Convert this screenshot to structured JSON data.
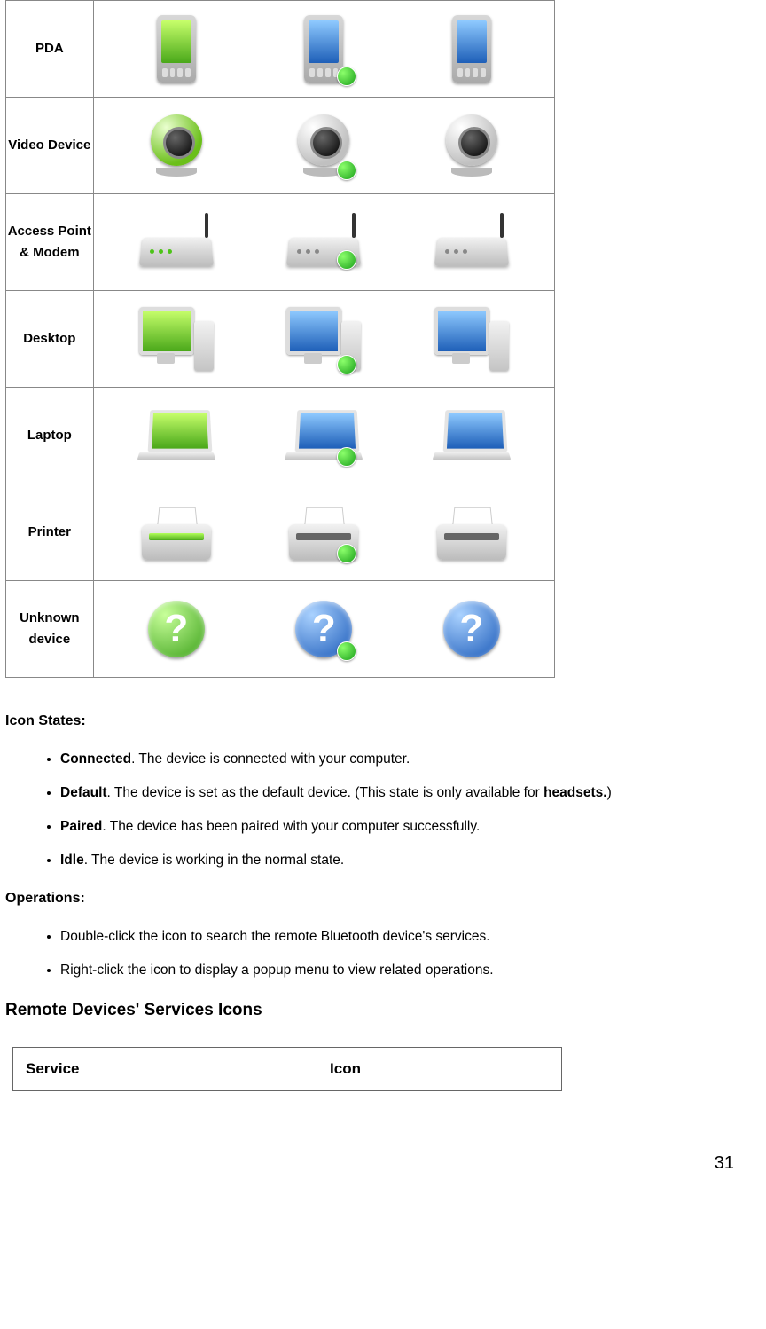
{
  "device_rows": [
    {
      "label": "PDA"
    },
    {
      "label": "Video Device"
    },
    {
      "label": "Access Point & Modem"
    },
    {
      "label": "Desktop"
    },
    {
      "label": "Laptop"
    },
    {
      "label": "Printer"
    },
    {
      "label": "Unknown device"
    }
  ],
  "icon_states_heading": "Icon States:",
  "icon_states": [
    {
      "term": "Connected",
      "desc": ". The device is connected with your computer."
    },
    {
      "term": "Default",
      "desc": ". The device is set as the default device. (This state is only available for ",
      "term2": "headsets.",
      "desc2": ")"
    },
    {
      "term": "Paired",
      "desc": ". The device has been paired with your computer successfully."
    },
    {
      "term": "Idle",
      "desc": ". The device is working in the normal state."
    }
  ],
  "operations_heading": "Operations:",
  "operations": [
    "Double-click the icon to search the remote Bluetooth device's services.",
    "Right-click the icon to display a popup menu to view related operations."
  ],
  "services_heading": "Remote Devices' Services Icons",
  "service_table": {
    "col1": "Service",
    "col2": "Icon"
  },
  "page_number": "31"
}
